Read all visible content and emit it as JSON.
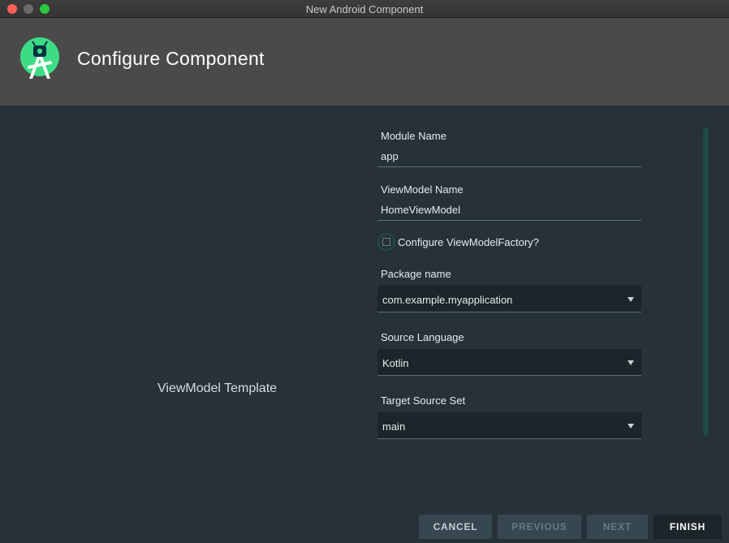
{
  "window": {
    "title": "New Android Component"
  },
  "header": {
    "title": "Configure Component",
    "logo_icon": "android-studio-logo-icon"
  },
  "left_panel": {
    "label": "ViewModel Template"
  },
  "form": {
    "module_name": {
      "label": "Module Name",
      "value": "app"
    },
    "viewmodel_name": {
      "label": "ViewModel Name",
      "value": "HomeViewModel"
    },
    "viewmodel_factory": {
      "label": "Configure ViewModelFactory?",
      "checked": false
    },
    "package_name": {
      "label": "Package name",
      "value": "com.example.myapplication"
    },
    "source_language": {
      "label": "Source Language",
      "value": "Kotlin"
    },
    "target_source_set": {
      "label": "Target Source Set",
      "value": "main"
    }
  },
  "buttons": {
    "cancel": "CANCEL",
    "previous": "PREVIOUS",
    "next": "NEXT",
    "finish": "FINISH"
  },
  "colors": {
    "background": "#263238",
    "header": "#4a4a4a",
    "accent_green": "#3ddc84",
    "scrollbar": "#1e4a48"
  }
}
